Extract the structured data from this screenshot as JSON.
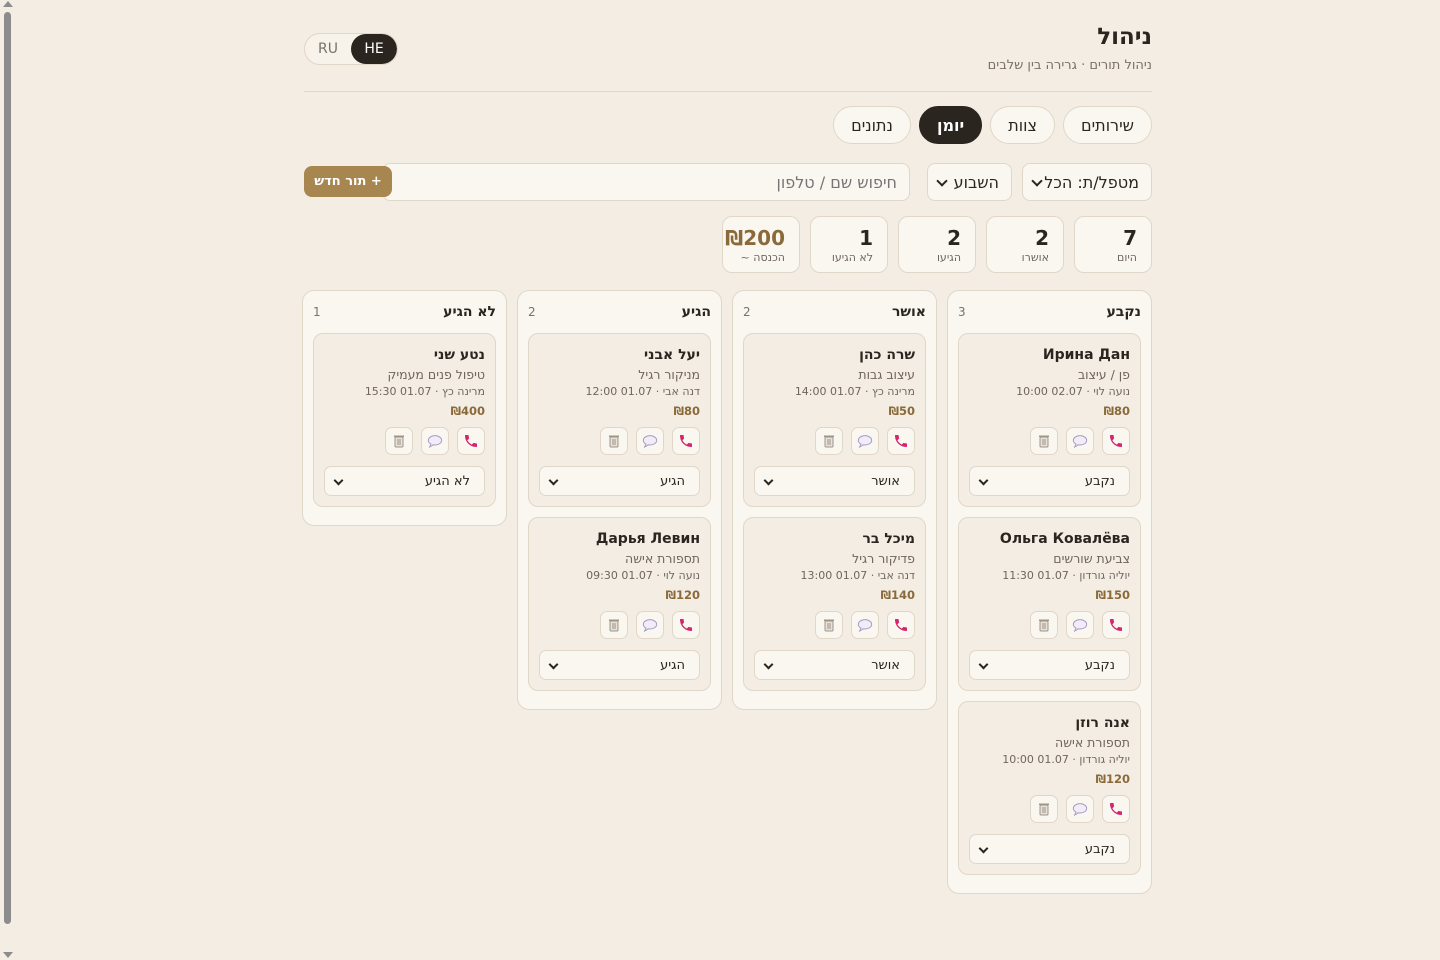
{
  "header": {
    "title": "ניהול",
    "subtitle": "ניהול תורים · גרירה בין שלבים"
  },
  "lang": {
    "options": [
      "RU",
      "HE"
    ],
    "active": "HE"
  },
  "tabs": [
    {
      "label": "שירותים",
      "active": false
    },
    {
      "label": "צוות",
      "active": false
    },
    {
      "label": "יומן",
      "active": true
    },
    {
      "label": "נתונים",
      "active": false
    }
  ],
  "filters": {
    "staff": "מטפל/ת: הכל",
    "period": "השבוע",
    "search_placeholder": "חיפוש שם / טלפון",
    "new_button": "+ תור חדש"
  },
  "stats": [
    {
      "value": "7",
      "label": "היום"
    },
    {
      "value": "2",
      "label": "אושרו"
    },
    {
      "value": "2",
      "label": "הגיעו"
    },
    {
      "value": "1",
      "label": "לא הגיעו"
    },
    {
      "value": "₪200",
      "label": "הכנסה ~"
    }
  ],
  "columns": [
    {
      "title": "נקבע",
      "count": "3",
      "cards": [
        {
          "name": "Ирина Дан",
          "service": "פן / עיצוב",
          "meta": "נועה לוי · 02.07 10:00",
          "price": "₪80",
          "status": "נקבע"
        },
        {
          "name": "Ольга Ковалёва",
          "service": "צביעת שורשים",
          "meta": "יוליה גורדון · 01.07 11:30",
          "price": "₪150",
          "status": "נקבע"
        },
        {
          "name": "אנה רוזן",
          "service": "תספורת אישה",
          "meta": "יוליה גורדון · 01.07 10:00",
          "price": "₪120",
          "status": "נקבע"
        }
      ]
    },
    {
      "title": "אושר",
      "count": "2",
      "cards": [
        {
          "name": "שרה כהן",
          "service": "עיצוב גבות",
          "meta": "מרינה כץ · 01.07 14:00",
          "price": "₪50",
          "status": "אושר"
        },
        {
          "name": "מיכל בר",
          "service": "פדיקור רגיל",
          "meta": "דנה אבי · 01.07 13:00",
          "price": "₪140",
          "status": "אושר"
        }
      ]
    },
    {
      "title": "הגיע",
      "count": "2",
      "cards": [
        {
          "name": "יעל אבני",
          "service": "מניקור רגיל",
          "meta": "דנה אבי · 01.07 12:00",
          "price": "₪80",
          "status": "הגיע"
        },
        {
          "name": "Дарья Левин",
          "service": "תספורת אישה",
          "meta": "נועה לוי · 01.07 09:30",
          "price": "₪120",
          "status": "הגיע"
        }
      ]
    },
    {
      "title": "לא הגיע",
      "count": "1",
      "cards": [
        {
          "name": "נטע שני",
          "service": "טיפול פנים מעמיק",
          "meta": "מרינה כץ · 01.07 15:30",
          "price": "₪400",
          "status": "לא הגיע"
        }
      ]
    }
  ],
  "icons": {
    "call": "phone-icon",
    "message": "chat-bubble-icon",
    "delete": "trash-icon"
  },
  "colors": {
    "accent": "#a88650",
    "dark": "#2b2520",
    "background": "#f3ede3",
    "phone": "#d6246e"
  }
}
